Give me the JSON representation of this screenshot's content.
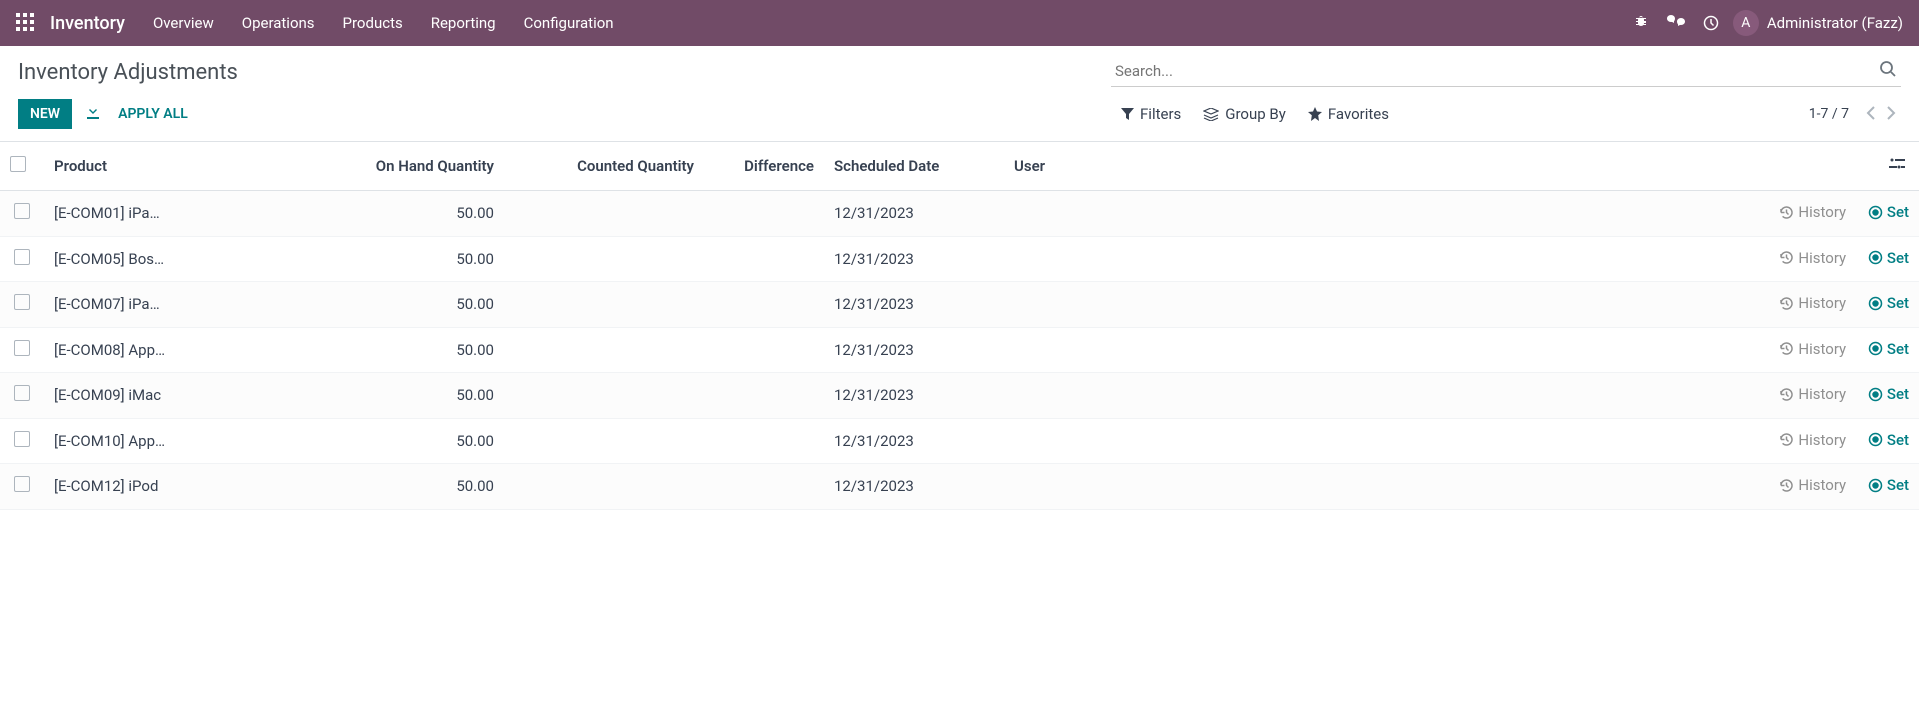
{
  "topnav": {
    "app_name": "Inventory",
    "menu": [
      "Overview",
      "Operations",
      "Products",
      "Reporting",
      "Configuration"
    ],
    "avatar_letter": "A",
    "username": "Administrator (Fazz)"
  },
  "header": {
    "title": "Inventory Adjustments",
    "search_placeholder": "Search...",
    "new_label": "NEW",
    "apply_all_label": "APPLY ALL",
    "filters_label": "Filters",
    "group_by_label": "Group By",
    "favorites_label": "Favorites",
    "pager": "1-7 / 7"
  },
  "columns": {
    "product": "Product",
    "on_hand": "On Hand Quantity",
    "counted": "Counted Quantity",
    "difference": "Difference",
    "scheduled": "Scheduled Date",
    "user": "User"
  },
  "row_actions": {
    "history": "History",
    "set": "Set"
  },
  "rows": [
    {
      "product": "[E-COM01] iPa…",
      "on_hand": "50.00",
      "counted": "",
      "difference": "",
      "scheduled": "12/31/2023",
      "user": ""
    },
    {
      "product": "[E-COM05] Bos…",
      "on_hand": "50.00",
      "counted": "",
      "difference": "",
      "scheduled": "12/31/2023",
      "user": ""
    },
    {
      "product": "[E-COM07] iPa…",
      "on_hand": "50.00",
      "counted": "",
      "difference": "",
      "scheduled": "12/31/2023",
      "user": ""
    },
    {
      "product": "[E-COM08] App…",
      "on_hand": "50.00",
      "counted": "",
      "difference": "",
      "scheduled": "12/31/2023",
      "user": ""
    },
    {
      "product": "[E-COM09] iMac",
      "on_hand": "50.00",
      "counted": "",
      "difference": "",
      "scheduled": "12/31/2023",
      "user": ""
    },
    {
      "product": "[E-COM10] App…",
      "on_hand": "50.00",
      "counted": "",
      "difference": "",
      "scheduled": "12/31/2023",
      "user": ""
    },
    {
      "product": "[E-COM12] iPod",
      "on_hand": "50.00",
      "counted": "",
      "difference": "",
      "scheduled": "12/31/2023",
      "user": ""
    }
  ]
}
